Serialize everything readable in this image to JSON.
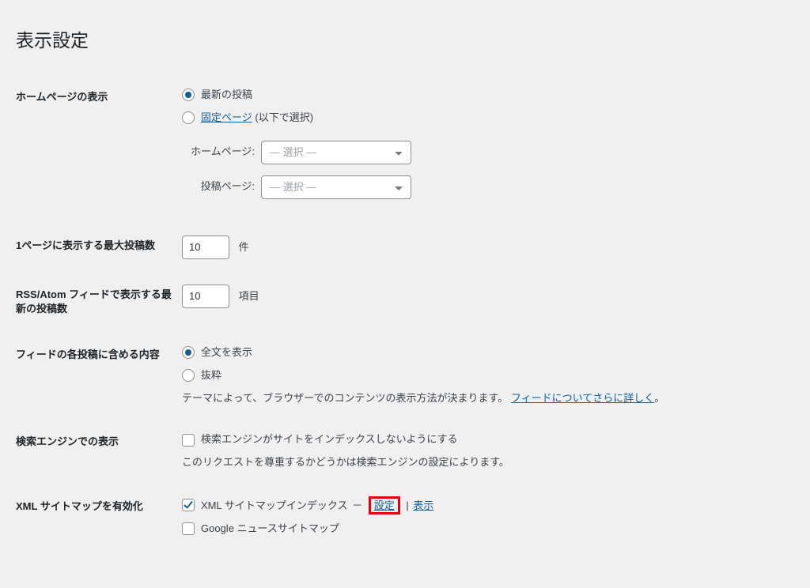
{
  "page_title": "表示設定",
  "homepage": {
    "section_label": "ホームページの表示",
    "option_latest": "最新の投稿",
    "option_static_link": "固定ページ",
    "option_static_suffix": "(以下で選択)",
    "homepage_label": "ホームページ:",
    "posts_page_label": "投稿ページ:",
    "select_placeholder": "— 選択 —"
  },
  "posts_per_page": {
    "section_label": "1ページに表示する最大投稿数",
    "value": "10",
    "unit": "件"
  },
  "rss_posts": {
    "section_label": "RSS/Atom フィードで表示する最新の投稿数",
    "value": "10",
    "unit": "項目"
  },
  "feed_content": {
    "section_label": "フィードの各投稿に含める内容",
    "option_full": "全文を表示",
    "option_excerpt": "抜粋",
    "note_prefix": "テーマによって、ブラウザーでのコンテンツの表示方法が決まります。",
    "note_link": "フィードについてさらに詳しく",
    "note_period": "。"
  },
  "search_visibility": {
    "section_label": "検索エンジンでの表示",
    "checkbox_label": "検索エンジンがサイトをインデックスしないようにする",
    "note": "このリクエストを尊重するかどうかは検索エンジンの設定によります。"
  },
  "xml_sitemap": {
    "section_label": "XML サイトマップを有効化",
    "index_label": "XML サイトマップインデックス",
    "dash": "－",
    "settings_link": "設定",
    "pipe": "|",
    "view_link": "表示",
    "google_news_label": "Google ニュースサイトマップ"
  }
}
